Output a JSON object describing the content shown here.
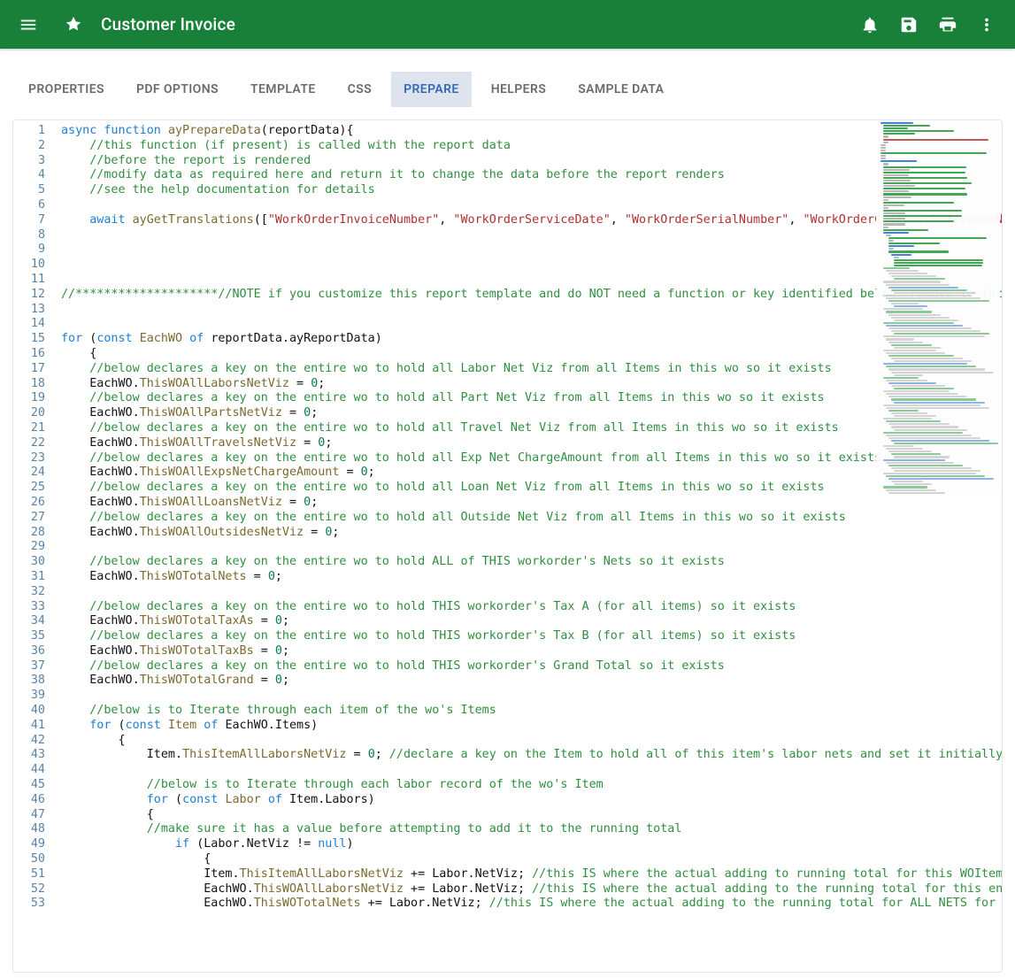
{
  "header": {
    "title": "Customer Invoice"
  },
  "tabs": [
    {
      "id": "properties",
      "label": "PROPERTIES",
      "active": false
    },
    {
      "id": "pdfoptions",
      "label": "PDF OPTIONS",
      "active": false
    },
    {
      "id": "template",
      "label": "TEMPLATE",
      "active": false
    },
    {
      "id": "css",
      "label": "CSS",
      "active": false
    },
    {
      "id": "prepare",
      "label": "PREPARE",
      "active": true
    },
    {
      "id": "helpers",
      "label": "HELPERS",
      "active": false
    },
    {
      "id": "sampledata",
      "label": "SAMPLE DATA",
      "active": false
    }
  ],
  "editor": {
    "first_line": 1,
    "last_line": 53,
    "lines": [
      {
        "n": 1,
        "indent": 0,
        "tokens": [
          [
            "kw",
            "async"
          ],
          [
            "sp",
            " "
          ],
          [
            "kw",
            "function"
          ],
          [
            "sp",
            " "
          ],
          [
            "fn",
            "ayPrepareData"
          ],
          [
            "id",
            "(reportData){"
          ]
        ]
      },
      {
        "n": 2,
        "indent": 1,
        "tokens": [
          [
            "cmt",
            "//this function (if present) is called with the report data"
          ]
        ]
      },
      {
        "n": 3,
        "indent": 1,
        "tokens": [
          [
            "cmt",
            "//before the report is rendered"
          ]
        ]
      },
      {
        "n": 4,
        "indent": 1,
        "tokens": [
          [
            "cmt",
            "//modify data as required here and return it to change the data before the report renders"
          ]
        ]
      },
      {
        "n": 5,
        "indent": 1,
        "tokens": [
          [
            "cmt",
            "//see the help documentation for details"
          ]
        ]
      },
      {
        "n": 6,
        "indent": 1,
        "tokens": []
      },
      {
        "n": 7,
        "indent": 1,
        "tokens": [
          [
            "kw",
            "await"
          ],
          [
            "sp",
            " "
          ],
          [
            "fn",
            "ayGetTranslations"
          ],
          [
            "id",
            "(["
          ],
          [
            "str",
            "\"WorkOrderInvoiceNumber\""
          ],
          [
            "id",
            ", "
          ],
          [
            "str",
            "\"WorkOrderServiceDate\""
          ],
          [
            "id",
            ", "
          ],
          [
            "str",
            "\"WorkOrderSerialNumber\""
          ],
          [
            "id",
            ", "
          ],
          [
            "str",
            "\"WorkOrderCustomerReferenceNumbe"
          ]
        ]
      },
      {
        "n": 8,
        "indent": 1,
        "tokens": []
      },
      {
        "n": 9,
        "indent": 0,
        "tokens": []
      },
      {
        "n": 10,
        "indent": 0,
        "tokens": []
      },
      {
        "n": 11,
        "indent": 0,
        "tokens": []
      },
      {
        "n": 12,
        "indent": 0,
        "tokens": [
          [
            "cmt",
            "//********************//NOTE if you customize this report template and do NOT need a function or key identified below, remove to increas"
          ]
        ]
      },
      {
        "n": 13,
        "indent": 0,
        "tokens": []
      },
      {
        "n": 14,
        "indent": 0,
        "tokens": []
      },
      {
        "n": 15,
        "indent": 0,
        "tokens": [
          [
            "kw",
            "for"
          ],
          [
            "sp",
            " "
          ],
          [
            "id",
            "("
          ],
          [
            "kw",
            "const"
          ],
          [
            "sp",
            " "
          ],
          [
            "fn",
            "EachWO"
          ],
          [
            "sp",
            " "
          ],
          [
            "kw",
            "of"
          ],
          [
            "sp",
            " "
          ],
          [
            "id",
            "reportData.ayReportData)"
          ]
        ]
      },
      {
        "n": 16,
        "indent": 1,
        "tokens": [
          [
            "id",
            "{"
          ]
        ]
      },
      {
        "n": 17,
        "indent": 1,
        "tokens": [
          [
            "cmt",
            "//below declares a key on the entire wo to hold all Labor Net Viz from all Items in this wo so it exists"
          ]
        ]
      },
      {
        "n": 18,
        "indent": 1,
        "tokens": [
          [
            "id",
            "EachWO."
          ],
          [
            "fn",
            "ThisWOAllLaborsNetViz"
          ],
          [
            "id",
            " = "
          ],
          [
            "num",
            "0"
          ],
          [
            "id",
            ";"
          ]
        ]
      },
      {
        "n": 19,
        "indent": 1,
        "tokens": [
          [
            "cmt",
            "//below declares a key on the entire wo to hold all Part Net Viz from all Items in this wo so it exists"
          ]
        ]
      },
      {
        "n": 20,
        "indent": 1,
        "tokens": [
          [
            "id",
            "EachWO."
          ],
          [
            "fn",
            "ThisWOAllPartsNetViz"
          ],
          [
            "id",
            " = "
          ],
          [
            "num",
            "0"
          ],
          [
            "id",
            ";"
          ]
        ]
      },
      {
        "n": 21,
        "indent": 1,
        "tokens": [
          [
            "cmt",
            "//below declares a key on the entire wo to hold all Travel Net Viz from all Items in this wo so it exists"
          ]
        ]
      },
      {
        "n": 22,
        "indent": 1,
        "tokens": [
          [
            "id",
            "EachWO."
          ],
          [
            "fn",
            "ThisWOAllTravelsNetViz"
          ],
          [
            "id",
            " = "
          ],
          [
            "num",
            "0"
          ],
          [
            "id",
            ";"
          ]
        ]
      },
      {
        "n": 23,
        "indent": 1,
        "tokens": [
          [
            "cmt",
            "//below declares a key on the entire wo to hold all Exp Net ChargeAmount from all Items in this wo so it exists"
          ]
        ]
      },
      {
        "n": 24,
        "indent": 1,
        "tokens": [
          [
            "id",
            "EachWO."
          ],
          [
            "fn",
            "ThisWOAllExpsNetChargeAmount"
          ],
          [
            "id",
            " = "
          ],
          [
            "num",
            "0"
          ],
          [
            "id",
            ";"
          ]
        ]
      },
      {
        "n": 25,
        "indent": 1,
        "tokens": [
          [
            "cmt",
            "//below declares a key on the entire wo to hold all Loan Net Viz from all Items in this wo so it exists"
          ]
        ]
      },
      {
        "n": 26,
        "indent": 1,
        "tokens": [
          [
            "id",
            "EachWO."
          ],
          [
            "fn",
            "ThisWOAllLoansNetViz"
          ],
          [
            "id",
            " = "
          ],
          [
            "num",
            "0"
          ],
          [
            "id",
            ";"
          ]
        ]
      },
      {
        "n": 27,
        "indent": 1,
        "tokens": [
          [
            "cmt",
            "//below declares a key on the entire wo to hold all Outside Net Viz from all Items in this wo so it exists"
          ]
        ]
      },
      {
        "n": 28,
        "indent": 1,
        "tokens": [
          [
            "id",
            "EachWO."
          ],
          [
            "fn",
            "ThisWOAllOutsidesNetViz"
          ],
          [
            "id",
            " = "
          ],
          [
            "num",
            "0"
          ],
          [
            "id",
            ";"
          ]
        ]
      },
      {
        "n": 29,
        "indent": 1,
        "tokens": []
      },
      {
        "n": 30,
        "indent": 1,
        "tokens": [
          [
            "cmt",
            "//below declares a key on the entire wo to hold ALL of THIS workorder's Nets so it exists"
          ]
        ]
      },
      {
        "n": 31,
        "indent": 1,
        "tokens": [
          [
            "id",
            "EachWO."
          ],
          [
            "fn",
            "ThisWOTotalNets"
          ],
          [
            "id",
            " = "
          ],
          [
            "num",
            "0"
          ],
          [
            "id",
            ";"
          ]
        ]
      },
      {
        "n": 32,
        "indent": 1,
        "tokens": []
      },
      {
        "n": 33,
        "indent": 1,
        "tokens": [
          [
            "cmt",
            "//below declares a key on the entire wo to hold THIS workorder's Tax A (for all items) so it exists"
          ]
        ]
      },
      {
        "n": 34,
        "indent": 1,
        "tokens": [
          [
            "id",
            "EachWO."
          ],
          [
            "fn",
            "ThisWOTotalTaxAs"
          ],
          [
            "id",
            " = "
          ],
          [
            "num",
            "0"
          ],
          [
            "id",
            ";"
          ]
        ]
      },
      {
        "n": 35,
        "indent": 1,
        "tokens": [
          [
            "cmt",
            "//below declares a key on the entire wo to hold THIS workorder's Tax B (for all items) so it exists"
          ]
        ]
      },
      {
        "n": 36,
        "indent": 1,
        "tokens": [
          [
            "id",
            "EachWO."
          ],
          [
            "fn",
            "ThisWOTotalTaxBs"
          ],
          [
            "id",
            " = "
          ],
          [
            "num",
            "0"
          ],
          [
            "id",
            ";"
          ]
        ]
      },
      {
        "n": 37,
        "indent": 1,
        "tokens": [
          [
            "cmt",
            "//below declares a key on the entire wo to hold THIS workorder's Grand Total so it exists"
          ]
        ]
      },
      {
        "n": 38,
        "indent": 1,
        "tokens": [
          [
            "id",
            "EachWO."
          ],
          [
            "fn",
            "ThisWOTotalGrand"
          ],
          [
            "id",
            " = "
          ],
          [
            "num",
            "0"
          ],
          [
            "id",
            ";"
          ]
        ]
      },
      {
        "n": 39,
        "indent": 1,
        "tokens": []
      },
      {
        "n": 40,
        "indent": 1,
        "tokens": [
          [
            "cmt",
            "//below is to Iterate through each item of the wo's Items"
          ]
        ]
      },
      {
        "n": 41,
        "indent": 1,
        "tokens": [
          [
            "kw",
            "for"
          ],
          [
            "sp",
            " "
          ],
          [
            "id",
            "("
          ],
          [
            "kw",
            "const"
          ],
          [
            "sp",
            " "
          ],
          [
            "fn",
            "Item"
          ],
          [
            "sp",
            " "
          ],
          [
            "kw",
            "of"
          ],
          [
            "sp",
            " "
          ],
          [
            "id",
            "EachWO.Items)"
          ]
        ]
      },
      {
        "n": 42,
        "indent": 2,
        "tokens": [
          [
            "id",
            "{"
          ]
        ]
      },
      {
        "n": 43,
        "indent": 3,
        "tokens": [
          [
            "id",
            "Item."
          ],
          [
            "fn",
            "ThisItemAllLaborsNetViz"
          ],
          [
            "id",
            " = "
          ],
          [
            "num",
            "0"
          ],
          [
            "id",
            "; "
          ],
          [
            "cmt",
            "//declare a key on the Item to hold all of this item's labor nets and set it initially to"
          ]
        ]
      },
      {
        "n": 44,
        "indent": 3,
        "tokens": []
      },
      {
        "n": 45,
        "indent": 3,
        "tokens": [
          [
            "cmt",
            "//below is to Iterate through each labor record of the wo's Item"
          ]
        ]
      },
      {
        "n": 46,
        "indent": 3,
        "tokens": [
          [
            "kw",
            "for"
          ],
          [
            "sp",
            " "
          ],
          [
            "id",
            "("
          ],
          [
            "kw",
            "const"
          ],
          [
            "sp",
            " "
          ],
          [
            "fn",
            "Labor"
          ],
          [
            "sp",
            " "
          ],
          [
            "kw",
            "of"
          ],
          [
            "sp",
            " "
          ],
          [
            "id",
            "Item.Labors)"
          ]
        ]
      },
      {
        "n": 47,
        "indent": 3,
        "tokens": [
          [
            "id",
            "{"
          ]
        ]
      },
      {
        "n": 48,
        "indent": 3,
        "tokens": [
          [
            "cmt",
            "//make sure it has a value before attempting to add it to the running total"
          ]
        ]
      },
      {
        "n": 49,
        "indent": 4,
        "tokens": [
          [
            "kw",
            "if"
          ],
          [
            "sp",
            " "
          ],
          [
            "id",
            "(Labor.NetViz != "
          ],
          [
            "null",
            "null"
          ],
          [
            "id",
            ")"
          ]
        ]
      },
      {
        "n": 50,
        "indent": 5,
        "tokens": [
          [
            "id",
            "{"
          ]
        ]
      },
      {
        "n": 51,
        "indent": 5,
        "tokens": [
          [
            "id",
            "Item."
          ],
          [
            "fn",
            "ThisItemAllLaborsNetViz"
          ],
          [
            "id",
            " += Labor.NetViz; "
          ],
          [
            "cmt",
            "//this IS where the actual adding to running total for this WOItem"
          ]
        ]
      },
      {
        "n": 52,
        "indent": 5,
        "tokens": [
          [
            "id",
            "EachWO."
          ],
          [
            "fn",
            "ThisWOAllLaborsNetViz"
          ],
          [
            "id",
            " += Labor.NetViz; "
          ],
          [
            "cmt",
            "//this IS where the actual adding to the running total for this en"
          ]
        ]
      },
      {
        "n": 53,
        "indent": 5,
        "tokens": [
          [
            "id",
            "EachWO."
          ],
          [
            "fn",
            "ThisWOTotalNets"
          ],
          [
            "id",
            " += Labor.NetViz; "
          ],
          [
            "cmt",
            "//this IS where the actual adding to the running total for ALL NETS for"
          ]
        ]
      }
    ]
  }
}
